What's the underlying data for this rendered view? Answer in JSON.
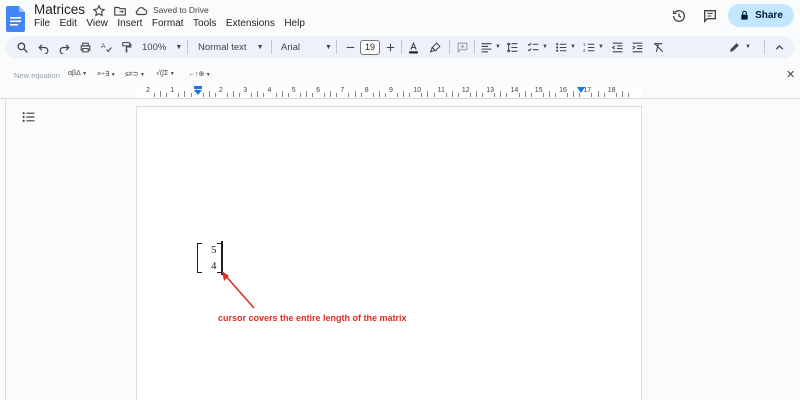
{
  "header": {
    "title": "Matrices",
    "saved_status": "Saved to Drive",
    "share_label": "Share"
  },
  "menu": [
    "File",
    "Edit",
    "View",
    "Insert",
    "Format",
    "Tools",
    "Extensions",
    "Help"
  ],
  "toolbar": {
    "zoom": "100%",
    "style": "Normal text",
    "font": "Arial",
    "font_size": "19"
  },
  "equation_bar": {
    "label": "New equation",
    "groups": [
      "αβΔ",
      "×÷∃",
      "≤≠⊃",
      "√(∫Σ",
      "←↑⊕"
    ]
  },
  "ruler": {
    "numbers": [
      "2",
      "1",
      "1",
      "2",
      "3",
      "4",
      "5",
      "6",
      "7",
      "8",
      "9",
      "10",
      "11",
      "12",
      "13",
      "14",
      "15",
      "16",
      "17",
      "18"
    ]
  },
  "matrix": {
    "values": [
      "5",
      "4"
    ]
  },
  "annotation": {
    "text": "cursor covers the entire length of the matrix",
    "color": "#d93025"
  },
  "colors": {
    "accent": "#1a73e8",
    "share_bg": "#c2e7ff",
    "toolbar_bg": "#edf2fa"
  }
}
